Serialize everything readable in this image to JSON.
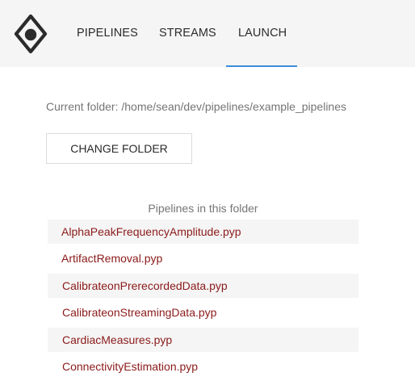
{
  "nav": {
    "logo_icon": "eye-in-diamond-logo-icon",
    "tabs": [
      {
        "label": "PIPELINES"
      },
      {
        "label": "STREAMS"
      },
      {
        "label": "LAUNCH",
        "active": true
      }
    ],
    "active_color": "#3a8ed8"
  },
  "launch": {
    "current_folder": "Current folder: /home/sean/dev/pipelines/example_pipelines",
    "change_folder_label": "CHANGE FOLDER",
    "list_title": "Pipelines in this folder",
    "link_color": "#8b1a1a",
    "pipelines": [
      "AlphaPeakFrequencyAmplitude.pyp",
      "ArtifactRemoval.pyp",
      "CalibrateonPrerecordedData.pyp",
      "CalibrateonStreamingData.pyp",
      "CardiacMeasures.pyp",
      "ConnectivityEstimation.pyp"
    ]
  }
}
